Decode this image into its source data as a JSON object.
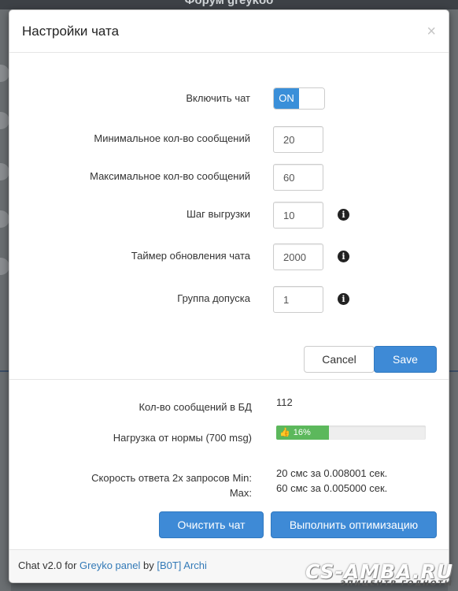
{
  "background": {
    "title": "Форум greykoo"
  },
  "modal": {
    "title": "Настройки чата",
    "close_glyph": "×"
  },
  "settings": {
    "enable_chat": {
      "label": "Включить чат",
      "state": "ON"
    },
    "min_messages": {
      "label": "Минимальное кол-во сообщений",
      "value": "20"
    },
    "max_messages": {
      "label": "Максимальное кол-во сообщений",
      "value": "60"
    },
    "load_step": {
      "label": "Шаг выгрузки",
      "value": "10"
    },
    "refresh_timer": {
      "label": "Таймер обновления чата",
      "value": "2000"
    },
    "access_group": {
      "label": "Группа допуска",
      "value": "1"
    }
  },
  "actions": {
    "cancel_label": "Cancel",
    "save_label": "Save"
  },
  "stats": {
    "db_count_label": "Кол-во сообщений в БД",
    "db_count_value": "112",
    "load_label": "Нагрузка от нормы (700 msg)",
    "load_percent": 16,
    "load_text": "16%",
    "speed_label_line1": "Скорость ответа 2х запросов Min:",
    "speed_label_line2": "Max:",
    "speed_min_value": "20 смс за 0.008001 сек.",
    "speed_max_value": "60 смс за 0.005000 сек."
  },
  "buttons": {
    "clear_chat": "Очистить чат",
    "optimize": "Выполнить оптимизацию"
  },
  "footer": {
    "prefix": "Chat v2.0 for ",
    "panel_link": "Greyko panel",
    "by": " by ",
    "author_link": "[B0T] Archi"
  },
  "watermark": {
    "main": "CS-AMBA.RU",
    "sub": "ЭПИЦЕНТР ГОДНОТЫ"
  },
  "colors": {
    "primary": "#3e8ad6",
    "toggle_on": "#3a8fd9",
    "progress": "#5cb85c",
    "link": "#337ab7"
  },
  "icons": {
    "info": "info-circle-icon",
    "thumb": "thumbs-up-icon"
  }
}
